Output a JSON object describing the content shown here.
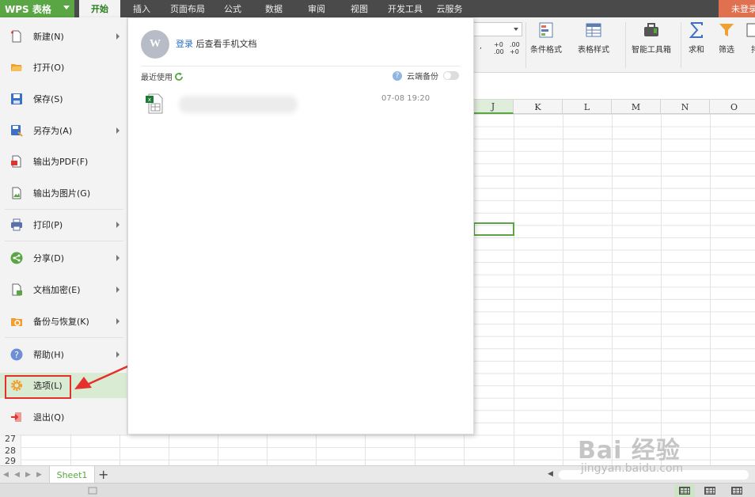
{
  "app": {
    "title": "WPS 表格"
  },
  "tabs": [
    {
      "label": "开始",
      "active": true
    },
    {
      "label": "插入"
    },
    {
      "label": "页面布局"
    },
    {
      "label": "公式"
    },
    {
      "label": "数据"
    },
    {
      "label": "审阅"
    },
    {
      "label": "视图"
    },
    {
      "label": "开发工具"
    },
    {
      "label": "云服务"
    }
  ],
  "login_button": "未登录",
  "ribbon": {
    "buttons": [
      {
        "label": "条件格式",
        "icon": "conditional-format-icon"
      },
      {
        "label": "表格样式",
        "icon": "table-style-icon"
      },
      {
        "label": "智能工具箱",
        "icon": "toolbox-icon"
      },
      {
        "label": "求和",
        "icon": "sum-icon"
      },
      {
        "label": "筛选",
        "icon": "filter-icon"
      },
      {
        "label": "排",
        "icon": "sort-icon"
      }
    ],
    "decimal_increase": "+0 .00",
    "decimal_decrease": ".00 +0"
  },
  "columns": [
    "J",
    "K",
    "L",
    "M",
    "N",
    "O"
  ],
  "row_numbers": [
    "27",
    "28",
    "29"
  ],
  "file_menu": {
    "items": [
      {
        "label": "新建(N)",
        "icon": "new-file-icon",
        "submenu": true
      },
      {
        "label": "打开(O)",
        "icon": "open-folder-icon",
        "submenu": false
      },
      {
        "label": "保存(S)",
        "icon": "save-icon",
        "submenu": false
      },
      {
        "label": "另存为(A)",
        "icon": "save-as-icon",
        "submenu": true
      },
      {
        "label": "输出为PDF(F)",
        "icon": "export-pdf-icon",
        "submenu": false
      },
      {
        "label": "输出为图片(G)",
        "icon": "export-image-icon",
        "submenu": false
      },
      {
        "label": "打印(P)",
        "icon": "print-icon",
        "submenu": true
      },
      {
        "label": "分享(D)",
        "icon": "share-icon",
        "submenu": true
      },
      {
        "label": "文档加密(E)",
        "icon": "encrypt-icon",
        "submenu": true
      },
      {
        "label": "备份与恢复(K)",
        "icon": "backup-icon",
        "submenu": true
      },
      {
        "label": "帮助(H)",
        "icon": "help-icon",
        "submenu": true
      },
      {
        "label": "选项(L)",
        "icon": "options-gear-icon",
        "submenu": false
      },
      {
        "label": "退出(Q)",
        "icon": "exit-icon",
        "submenu": false
      }
    ]
  },
  "recent_panel": {
    "login_link": "登录",
    "login_hint": " 后查看手机文档",
    "recent_label": "最近使用",
    "cloud_backup": "云端备份",
    "file_date": "07-08 19:20"
  },
  "sheet_bar": {
    "sheet_name": "Sheet1",
    "add": "+"
  },
  "watermark": {
    "brand": "Bai 经验",
    "url": "jingyan.baidu.com"
  }
}
